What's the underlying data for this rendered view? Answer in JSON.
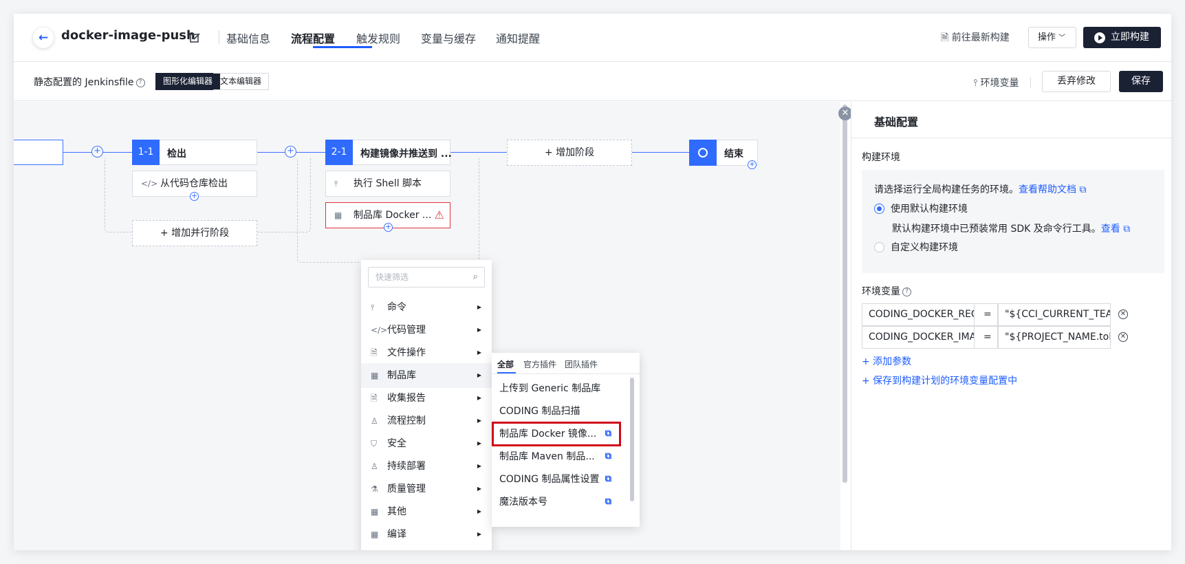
{
  "header": {
    "title": "docker-image-push",
    "tabs": [
      "基础信息",
      "流程配置",
      "触发规则",
      "变量与缓存",
      "通知提醒"
    ],
    "active_tab": "流程配置",
    "goto_latest": "前往最新构建",
    "ops_label": "操作",
    "run_label": "立即构建"
  },
  "subbar": {
    "jenkins_label": "静态配置的 Jenkinsfile",
    "graphical_editor": "图形化编辑器",
    "text_editor": "文本编辑器",
    "env_vars": "环境变量",
    "discard": "丢弃修改",
    "save": "保存"
  },
  "pipeline": {
    "stage1": {
      "num": "1-1",
      "name": "检出"
    },
    "stage1_step": "从代码仓库检出",
    "add_parallel": "+ 增加并行阶段",
    "stage2": {
      "num": "2-1",
      "name": "构建镜像并推送到 ..."
    },
    "stage2_step1": "执行 Shell 脚本",
    "stage2_step2": "制品库 Docker ...",
    "add_stage": "+ 增加阶段",
    "end": "结束"
  },
  "menu": {
    "filter_placeholder": "快速筛选",
    "items": [
      "命令",
      "代码管理",
      "文件操作",
      "制品库",
      "收集报告",
      "流程控制",
      "安全",
      "持续部署",
      "质量管理",
      "其他",
      "编译"
    ]
  },
  "submenu": {
    "tabs": [
      "全部",
      "官方插件",
      "团队插件"
    ],
    "items": [
      "上传到 Generic 制品库",
      "CODING 制品扫描",
      "制品库 Docker 镜像...",
      "制品库 Maven 制品...",
      "CODING 制品属性设置",
      "魔法版本号"
    ]
  },
  "panel": {
    "title": "基础配置",
    "build_env_label": "构建环境",
    "env_hint": "请选择运行全局构建任务的环境。",
    "help_doc": "查看帮助文档",
    "opt_default": "使用默认构建环境",
    "default_desc": "默认构建环境中已预装常用 SDK 及命令行工具。",
    "view": "查看",
    "opt_custom": "自定义构建环境",
    "env_vars_label": "环境变量",
    "vars": [
      {
        "key": "CODING_DOCKER_REG",
        "eq": "=",
        "value": "\"${CCI_CURRENT_TEAM"
      },
      {
        "key": "CODING_DOCKER_IMAG",
        "eq": "=",
        "value": "\"${PROJECT_NAME.toLo"
      }
    ],
    "add_param": "+ 添加参数",
    "save_to_plan": "+ 保存到构建计划的环境变量配置中"
  },
  "colors": {
    "accent": "#2f6bff",
    "dark": "#1a2133",
    "error": "#e0323b",
    "highlight": "#d0091a"
  }
}
